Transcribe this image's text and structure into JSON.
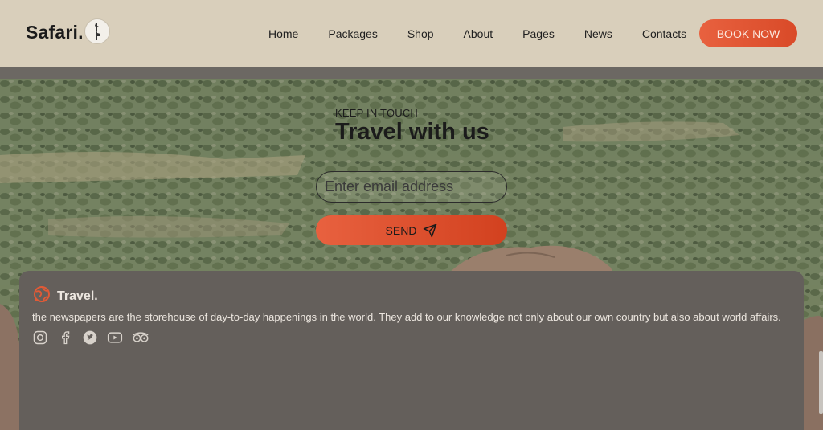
{
  "header": {
    "logo_text": "Safari.",
    "nav": [
      "Home",
      "Packages",
      "Shop",
      "About",
      "Pages",
      "News",
      "Contacts"
    ],
    "book_label": "BOOK NOW"
  },
  "newsletter": {
    "kicker": "KEEP IN TOUCH",
    "title": "Travel with us",
    "email_placeholder": "Enter email address",
    "send_label": "SEND"
  },
  "footer": {
    "brand": "Travel.",
    "description": "the newspapers are the storehouse of day-to-day happenings in the world. They add to our knowledge not only about our own country but also about world affairs.",
    "socials": [
      "instagram-icon",
      "facebook-icon",
      "twitter-icon",
      "youtube-icon",
      "tripadvisor-icon"
    ]
  },
  "colors": {
    "header_bg": "#d9cfbb",
    "accent": "#e15a36",
    "footer_bg": "#645f5b"
  }
}
